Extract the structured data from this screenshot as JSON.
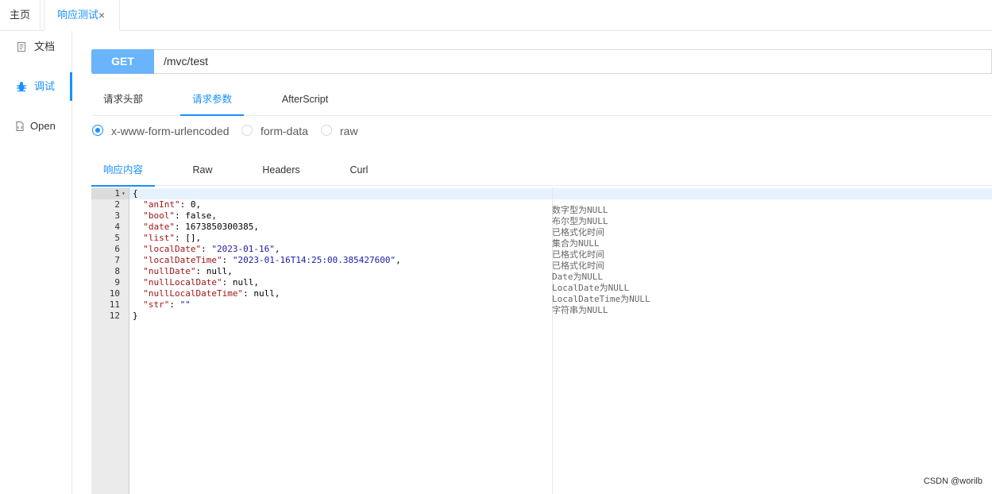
{
  "tabs": {
    "home": "主页",
    "active": "响应测试",
    "close": "×"
  },
  "sidebar": {
    "items": [
      {
        "label": "文档",
        "icon": "document-icon"
      },
      {
        "label": "调试",
        "icon": "bug-icon"
      },
      {
        "label": "Open",
        "icon": "file-code-icon"
      }
    ],
    "active_index": 1
  },
  "request": {
    "method": "GET",
    "url": "/mvc/test",
    "tabs": [
      "请求头部",
      "请求参数",
      "AfterScript"
    ],
    "active_tab": "请求参数",
    "body_types": [
      "x-www-form-urlencoded",
      "form-data",
      "raw"
    ],
    "selected_body_type": "x-www-form-urlencoded"
  },
  "response": {
    "tabs": [
      "响应内容",
      "Raw",
      "Headers",
      "Curl"
    ],
    "active_tab": "响应内容",
    "lines": [
      {
        "num": "1",
        "text": "{",
        "comment": ""
      },
      {
        "num": "2",
        "key": "\"anInt\"",
        "value": " 0,",
        "vtype": "n",
        "comment": "数字型为NULL"
      },
      {
        "num": "3",
        "key": "\"bool\"",
        "value": " false,",
        "vtype": "n",
        "comment": "布尔型为NULL"
      },
      {
        "num": "4",
        "key": "\"date\"",
        "value": " 1673850300385,",
        "vtype": "n",
        "comment": "已格式化时间"
      },
      {
        "num": "5",
        "key": "\"list\"",
        "value": " [],",
        "vtype": "n",
        "comment": "集合为NULL"
      },
      {
        "num": "6",
        "key": "\"localDate\"",
        "value": "\"2023-01-16\"",
        "vtype": "s",
        "comment": "已格式化时间"
      },
      {
        "num": "7",
        "key": "\"localDateTime\"",
        "value": "\"2023-01-16T14:25:00.385427600\"",
        "vtype": "s",
        "comment": "已格式化时间"
      },
      {
        "num": "8",
        "key": "\"nullDate\"",
        "value": " null,",
        "vtype": "n",
        "comment": "Date为NULL"
      },
      {
        "num": "9",
        "key": "\"nullLocalDate\"",
        "value": " null,",
        "vtype": "n",
        "comment": "LocalDate为NULL"
      },
      {
        "num": "10",
        "key": "\"nullLocalDateTime\"",
        "value": " null,",
        "vtype": "n",
        "comment": "LocalDateTime为NULL"
      },
      {
        "num": "11",
        "key": "\"str\"",
        "value": "\"\"",
        "vtype": "s",
        "comment": "字符串为NULL"
      },
      {
        "num": "12",
        "text": "}",
        "comment": ""
      }
    ]
  },
  "watermark": "CSDN @worilb",
  "colors": {
    "accent": "#1890ff",
    "method_bg": "#69b4fa"
  }
}
